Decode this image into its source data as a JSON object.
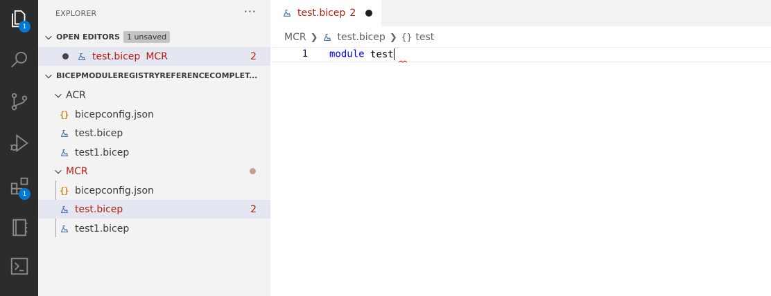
{
  "activity_bar": {
    "items": [
      {
        "icon": "files-icon",
        "badge": "1"
      },
      {
        "icon": "search-icon"
      },
      {
        "icon": "source-control-icon"
      },
      {
        "icon": "run-debug-icon"
      },
      {
        "icon": "extensions-icon",
        "badge": "1"
      },
      {
        "icon": "notebook-icon"
      },
      {
        "icon": "terminal-icon"
      }
    ]
  },
  "explorer": {
    "title": "EXPLORER",
    "more": "···",
    "open_editors": {
      "label": "OPEN EDITORS",
      "badge": "1 unsaved",
      "items": [
        {
          "name": "test.bicep",
          "folder": "MCR",
          "problems": "2"
        }
      ]
    },
    "workspace": {
      "label": "BICEPMODULEREGISTRYREFERENCECOMPLET...",
      "folders": [
        {
          "name": "ACR",
          "files": [
            {
              "name": "bicepconfig.json",
              "type": "json"
            },
            {
              "name": "test.bicep",
              "type": "bicep"
            },
            {
              "name": "test1.bicep",
              "type": "bicep"
            }
          ]
        },
        {
          "name": "MCR",
          "files": [
            {
              "name": "bicepconfig.json",
              "type": "json"
            },
            {
              "name": "test.bicep",
              "type": "bicep",
              "problems": "2"
            },
            {
              "name": "test1.bicep",
              "type": "bicep"
            }
          ]
        }
      ]
    }
  },
  "editor": {
    "tab": {
      "name": "test.bicep",
      "problems": "2"
    },
    "breadcrumbs": {
      "folder": "MCR",
      "file": "test.bicep",
      "symbol": "test"
    },
    "lines": [
      {
        "number": "1",
        "keyword": "module",
        "identifier": "test"
      }
    ]
  },
  "colors": {
    "activity_bar": "#2c2c2c",
    "sidebar": "#f3f3f3",
    "selection": "#e4e6f1",
    "error": "#b5200d",
    "badge": "#0078d4",
    "keyword": "#0000ff"
  }
}
